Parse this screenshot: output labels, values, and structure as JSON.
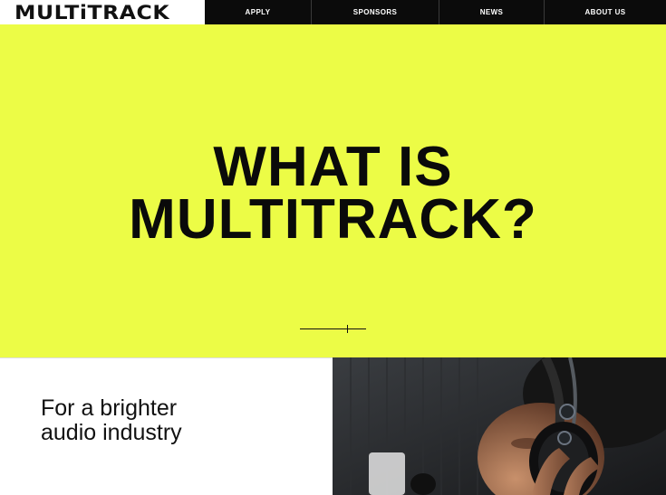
{
  "nav": {
    "logo": "MULTiTRACK",
    "items": [
      "APPLY",
      "SPONSORS",
      "NEWS",
      "ABOUT US"
    ]
  },
  "hero": {
    "title_line1": "WHAT IS",
    "title_line2": "MULTITRACK?",
    "background_color": "#ecfc46"
  },
  "section": {
    "tagline_line1": "For a brighter",
    "tagline_line2": "audio industry"
  }
}
